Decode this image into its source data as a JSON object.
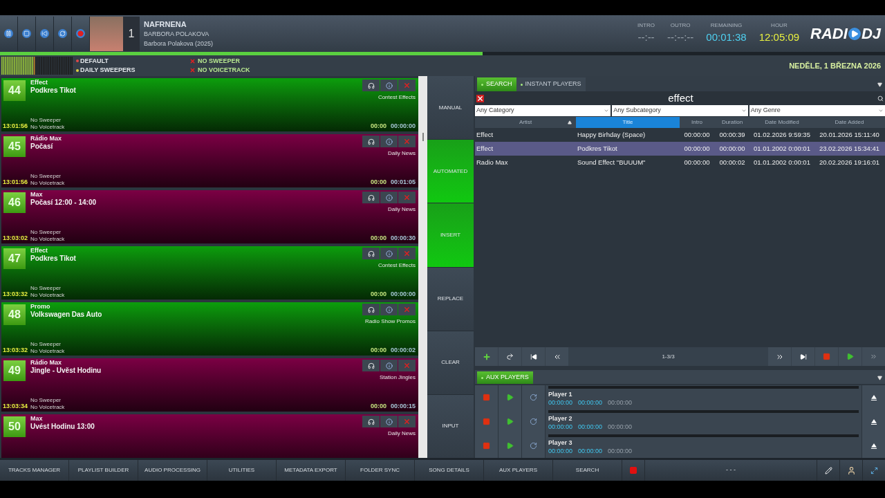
{
  "now_playing": {
    "deck": "1",
    "title": "NAFRNENA",
    "artist": "BARBORA POLAKOVA",
    "album": "Barbora Polakova (2025)"
  },
  "counters": [
    {
      "label": "INTRO",
      "value": "--:--",
      "kind": "neutral"
    },
    {
      "label": "OUTRO",
      "value": "--:--:--",
      "kind": "neutral"
    },
    {
      "label": "REMAINING",
      "value": "00:01:38",
      "kind": "remaining"
    },
    {
      "label": "HOUR",
      "value": "12:05:09",
      "kind": "clock"
    }
  ],
  "logo": {
    "left": "RADI",
    "right": "DJ"
  },
  "progress": {
    "level": 0.545
  },
  "rotations": [
    {
      "label": "DEFAULT",
      "color": "#e04848"
    },
    {
      "label": "DAILY SWEEPERS",
      "color": "#e0d040"
    }
  ],
  "flags": [
    "NO SWEEPER",
    "NO VOICETRACK"
  ],
  "date": "NEDĚLE, 1 BŘEZNA 2026",
  "playlist": [
    {
      "number": "44",
      "kind": "effect",
      "artist": "Effect",
      "title": "Podkres Tikot",
      "category": "Contest Effects",
      "time": "13:01:56",
      "sweeper": "No Sweeper",
      "voicetrack": "No Voicetrack",
      "cue": "00:00",
      "duration": "00:00:00"
    },
    {
      "number": "45",
      "kind": "news",
      "artist": "Rádio Max",
      "title": "Počasí",
      "category": "Daily News",
      "time": "13:01:56",
      "sweeper": "No Sweeper",
      "voicetrack": "No Voicetrack",
      "cue": "00:00",
      "duration": "00:01:05"
    },
    {
      "number": "46",
      "kind": "news",
      "artist": "Max",
      "title": "Počasí 12:00 - 14:00",
      "category": "Daily News",
      "time": "13:03:02",
      "sweeper": "No Sweeper",
      "voicetrack": "No Voicetrack",
      "cue": "00:00",
      "duration": "00:00:30"
    },
    {
      "number": "47",
      "kind": "effect",
      "artist": "Effect",
      "title": "Podkres Tikot",
      "category": "Contest Effects",
      "time": "13:03:32",
      "sweeper": "No Sweeper",
      "voicetrack": "No Voicetrack",
      "cue": "00:00",
      "duration": "00:00:00"
    },
    {
      "number": "48",
      "kind": "effect",
      "artist": "Promo",
      "title": "Volkswagen Das Auto",
      "category": "Radio Show Promos",
      "time": "13:03:32",
      "sweeper": "No Sweeper",
      "voicetrack": "No Voicetrack",
      "cue": "00:00",
      "duration": "00:00:02"
    },
    {
      "number": "49",
      "kind": "news",
      "artist": "Rádio Max",
      "title": "Jingle - Uvěst Hodinu",
      "category": "Station Jingles",
      "time": "13:03:34",
      "sweeper": "No Sweeper",
      "voicetrack": "No Voicetrack",
      "cue": "00:00",
      "duration": "00:00:15"
    },
    {
      "number": "50",
      "kind": "news",
      "artist": "Max",
      "title": "Uvést Hodinu 13:00",
      "category": "Daily News"
    }
  ],
  "modes": [
    {
      "label": "MANUAL",
      "selected": false
    },
    {
      "label": "AUTOMATED",
      "selected": true
    },
    {
      "label": "INSERT",
      "selected": true
    },
    {
      "label": "REPLACE",
      "selected": false
    },
    {
      "label": "CLEAR",
      "selected": false
    },
    {
      "label": "INPUT",
      "selected": false
    }
  ],
  "tabs": [
    {
      "label": "SEARCH",
      "selected": true
    },
    {
      "label": "INSTANT PLAYERS",
      "selected": false
    }
  ],
  "search": {
    "value": "effect"
  },
  "filters": [
    "Any Category",
    "Any Subcategory",
    "Any Genre"
  ],
  "table": {
    "columns": [
      {
        "label": "Artist",
        "sorted": true,
        "selected": false
      },
      {
        "label": "Title",
        "sorted": false,
        "selected": true
      },
      {
        "label": "Intro",
        "sorted": false,
        "selected": false
      },
      {
        "label": "Duration",
        "sorted": false,
        "selected": false
      },
      {
        "label": "Date Modified",
        "sorted": false,
        "selected": false
      },
      {
        "label": "Date Added",
        "sorted": false,
        "selected": false
      }
    ],
    "rows": [
      {
        "selected": false,
        "cells": [
          "Effect",
          "Happy Birhday (Space)",
          "00:00:00",
          "00:00:39",
          "01.02.2026 9:59:35",
          "20.01.2026 15:11:40"
        ]
      },
      {
        "selected": true,
        "cells": [
          "Effect",
          "Podkres Tikot",
          "00:00:00",
          "00:00:00",
          "01.01.2002 0:00:01",
          "23.02.2026 15:34:41"
        ]
      },
      {
        "selected": false,
        "cells": [
          "Radio Max",
          "Sound Effect \"BUUUM\"",
          "00:00:00",
          "00:00:02",
          "01.01.2002 0:00:01",
          "20.02.2026 19:16:01"
        ]
      }
    ]
  },
  "pager": "1-3/3",
  "aux_tabs": [
    {
      "label": "AUX PLAYERS",
      "selected": true
    }
  ],
  "aux_players": [
    {
      "name": "Player 1",
      "times": [
        "00:00:00",
        "00:00:00",
        "00:00:00"
      ]
    },
    {
      "name": "Player 2",
      "times": [
        "00:00:00",
        "00:00:00",
        "00:00:00"
      ]
    },
    {
      "name": "Player 3",
      "times": [
        "00:00:00",
        "00:00:00",
        "00:00:00"
      ]
    }
  ],
  "bottom_bar": [
    "TRACKS MANAGER",
    "PLAYLIST BUILDER",
    "AUDIO PROCESSING",
    "UTILITIES",
    "METADATA EXPORT",
    "FOLDER SYNC",
    "SONG DETAILS",
    "AUX PLAYERS",
    "SEARCH"
  ],
  "bottom_status": "- - -"
}
